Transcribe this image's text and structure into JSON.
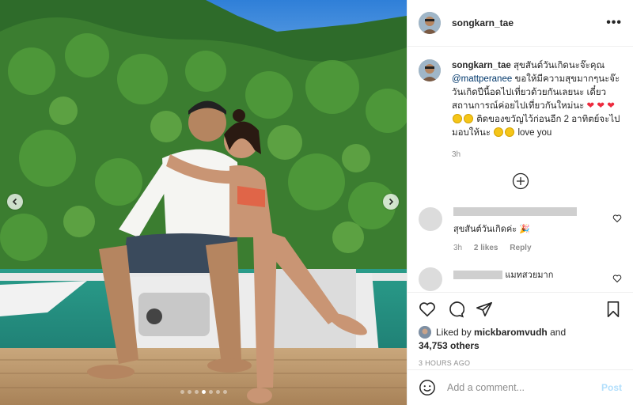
{
  "post": {
    "username": "songkarn_tae",
    "more_icon": "ellipsis-icon",
    "caption": {
      "username": "songkarn_tae",
      "text_1": "สุขสันต์วันเกิดนะจ๊ะคุณ",
      "mention": "@mattperanee",
      "text_2": "ขอให้มีความสุขมากๆนะจ๊ะ วันเกิดปีนี้อดไปเที่ยวด้วยกันเลยนะ เดี๋ยวสถานการณ์ค่อยไปเที่ยวกันใหม่นะ",
      "text_3": "ติดของขวัญไว้ก่อนอีก 2 อาทิตย์จะไปมอบให้นะ",
      "text_4": "love you",
      "time": "3h"
    },
    "comments": [
      {
        "text": "สุขสันต์วันเกิดค่ะ",
        "time": "3h",
        "likes": "2 likes",
        "reply": "Reply"
      },
      {
        "text": "แมทสวยมาก"
      }
    ],
    "liked_by_user": "mickbaromvudh",
    "liked_by_prefix": "Liked by",
    "liked_by_and": "and",
    "liked_by_others": "34,753 others",
    "posted_ago": "3 HOURS AGO",
    "add_comment_placeholder": "Add a comment...",
    "post_button": "Post"
  },
  "colors": {
    "heart": "#ed2b3e",
    "mention": "#00376b",
    "post_button": "#b2dffc",
    "meta_text": "#8e8e8e"
  }
}
